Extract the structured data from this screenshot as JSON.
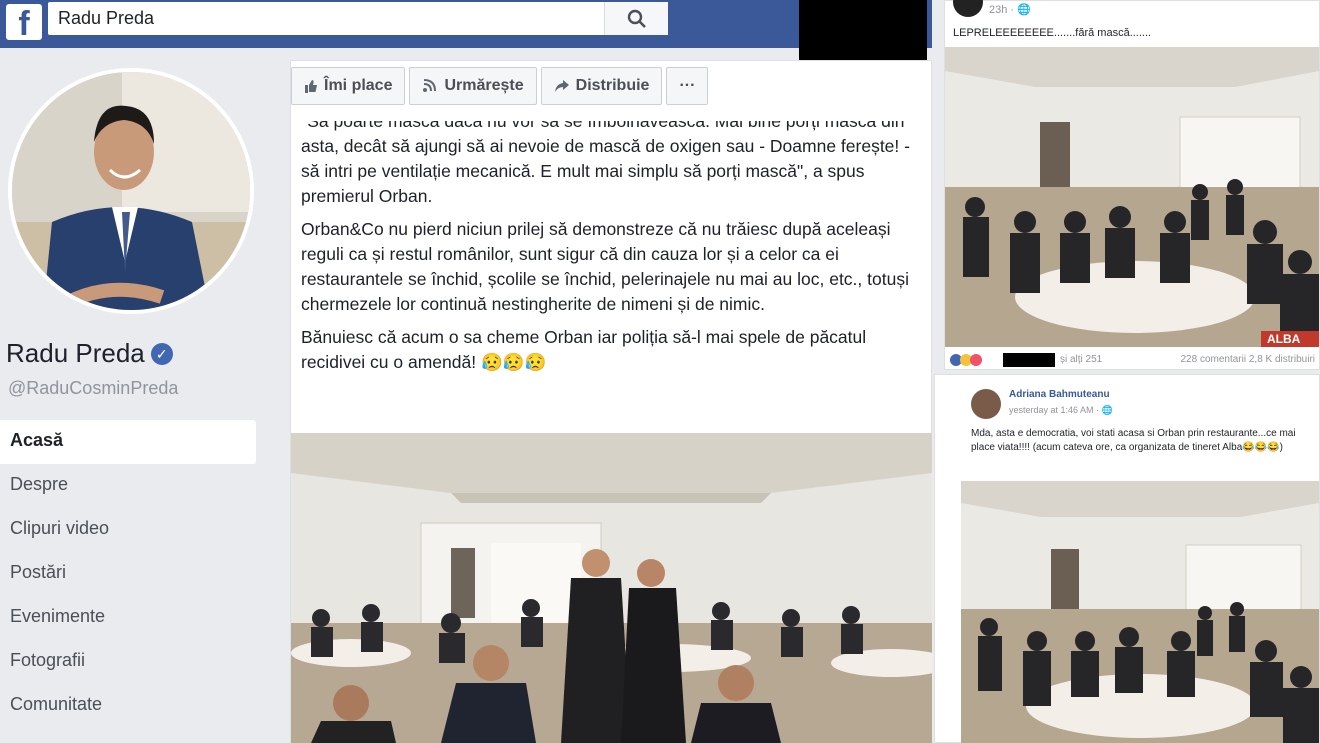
{
  "topbar": {
    "logo": "f",
    "search_value": "Radu Preda",
    "search_icon": "search-icon"
  },
  "profile": {
    "name": "Radu Preda",
    "verified_icon": "verified-badge-icon",
    "handle": "@RaduCosminPreda"
  },
  "nav": {
    "items": [
      {
        "label": "Acasă",
        "active": true
      },
      {
        "label": "Despre"
      },
      {
        "label": "Clipuri video"
      },
      {
        "label": "Postări"
      },
      {
        "label": "Evenimente"
      },
      {
        "label": "Fotografii"
      },
      {
        "label": "Comunitate"
      }
    ]
  },
  "actions": {
    "like": "Îmi place",
    "follow": "Urmărește",
    "share": "Distribuie",
    "more": "···"
  },
  "post": {
    "p1": "\"Să poarte mască dacă nu vor să se îmbolnăvească. Mai bine porți mască din asta, decât să ajungi să ai nevoie de mască de oxigen sau - Doamne ferește! - să intri pe ventilație mecanică. E mult mai simplu să porți mască\", a spus premierul Orban.",
    "p2": "Orban&Co nu pierd niciun prilej să demonstreze că nu trăiesc după aceleași reguli ca și restul românilor, sunt sigur că din cauza lor și a celor ca ei restaurantele se închid, școlile se închid, pelerinajele nu mai au loc, etc., totuși chermezele lor continuă nestingherite de nimeni și de nimic.",
    "p3": "Bănuiesc că acum o sa cheme Orban iar poliția să-l mai spele de păcatul recidivei cu o amendă! 😥😥😥"
  },
  "right_post_1": {
    "time": "23h · 🌐",
    "text": "LEPRELEEEEEEEE.......fără mască.......",
    "reactions_text": "și alți 251",
    "counts": "228 comentarii   2,8 K distribuiri",
    "photo_label": "ALBA"
  },
  "right_post_2": {
    "author": "Adriana Bahmuteanu",
    "time": "yesterday at 1:46 AM · 🌐",
    "text": "Mda, asta e democratia, voi stati acasa si Orban prin restaurante...ce mai place viata!!!! (acum cateva ore, ca organizata de tineret Alba😂😂😂)"
  }
}
